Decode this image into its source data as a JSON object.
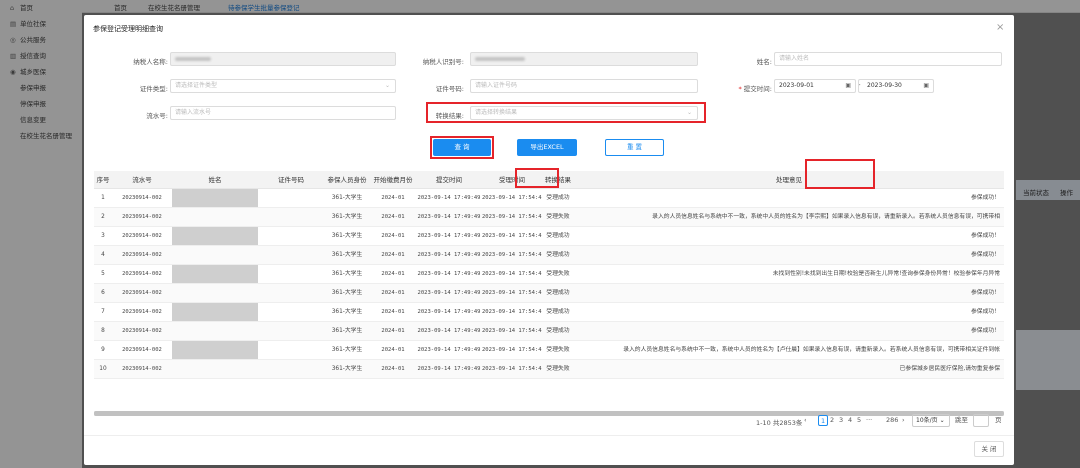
{
  "sidebar": {
    "items": [
      {
        "label": "首页",
        "icon": "home-icon",
        "glyph": "⌂"
      },
      {
        "label": "单位社保",
        "icon": "building-icon",
        "glyph": "▤"
      },
      {
        "label": "公共服务",
        "icon": "service-icon",
        "glyph": "◎"
      },
      {
        "label": "授信查询",
        "icon": "credit-icon",
        "glyph": "▥"
      },
      {
        "label": "城乡医保",
        "icon": "medical-icon",
        "glyph": "◉"
      },
      {
        "label": "参保申报",
        "sub": true
      },
      {
        "label": "停保申报",
        "sub": true
      },
      {
        "label": "信息变更",
        "sub": true
      },
      {
        "label": "在校生花名册管理",
        "sub": true
      }
    ]
  },
  "topbar": {
    "tabs": [
      "首页",
      "在校生花名册管理",
      "待参保学生批量参保登记"
    ],
    "active": 2
  },
  "background": {
    "col_status": "当前状态",
    "col_op": "操作"
  },
  "modal": {
    "title": "参保登记受理明细查询",
    "close": "×",
    "form": {
      "taxpayer_name_label": "纳税人名称:",
      "taxpayer_id_label": "纳税人识别号:",
      "name_label": "姓名:",
      "name_placeholder": "请输入姓名",
      "cert_type_label": "证件类型:",
      "cert_type_placeholder": "请选择证件类型",
      "cert_no_label": "证件号码:",
      "cert_no_placeholder": "请输入证件号码",
      "submit_time_label": "提交时间:",
      "date_from": "2023-09-01",
      "date_to": "2023-09-30",
      "date_sep": "-",
      "serial_label": "流水号:",
      "serial_placeholder": "请输入流水号",
      "result_label": "转换结果:",
      "result_placeholder": "请选择转换结果"
    },
    "buttons": {
      "query": "查 询",
      "export": "导出EXCEL",
      "reset": "重 置",
      "close": "关 闭"
    },
    "table": {
      "headers": [
        "序号",
        "流水号",
        "姓名",
        "证件号码",
        "参保人员身份",
        "开始缴费月份",
        "提交时间",
        "受理时间",
        "转换结果",
        "处理意见"
      ],
      "rows": [
        {
          "no": "1",
          "serial": "20230914-002",
          "identity": "361-大学生",
          "month": "2024-01",
          "submit": "2023-09-14 17:49:49",
          "accept": "2023-09-14 17:54:49",
          "result": "受理成功",
          "opinion": "参保成功！"
        },
        {
          "no": "2",
          "serial": "20230914-002",
          "identity": "361-大学生",
          "month": "2024-01",
          "submit": "2023-09-14 17:49:49",
          "accept": "2023-09-14 17:54:48",
          "result": "受理失败",
          "opinion": "录入的人员信息姓名与系统中不一致，系统中人员的姓名为【李宗熙】如果录入信息有误，请重新录入。若系统人员信息有误，可携带相"
        },
        {
          "no": "3",
          "serial": "20230914-002",
          "identity": "361-大学生",
          "month": "2024-01",
          "submit": "2023-09-14 17:49:49",
          "accept": "2023-09-14 17:54:48",
          "result": "受理成功",
          "opinion": "参保成功！"
        },
        {
          "no": "4",
          "serial": "20230914-002",
          "identity": "361-大学生",
          "month": "2024-01",
          "submit": "2023-09-14 17:49:49",
          "accept": "2023-09-14 17:54:47",
          "result": "受理成功",
          "opinion": "参保成功！"
        },
        {
          "no": "5",
          "serial": "20230914-002",
          "identity": "361-大学生",
          "month": "2024-01",
          "submit": "2023-09-14 17:49:49",
          "accept": "2023-09-14 17:54:46",
          "result": "受理失败",
          "opinion": "未找到性别!未找到出生日期!校验是否新生儿异常!查询参保身份异常！校验参保年月异常"
        },
        {
          "no": "6",
          "serial": "20230914-002",
          "identity": "361-大学生",
          "month": "2024-01",
          "submit": "2023-09-14 17:49:49",
          "accept": "2023-09-14 17:54:46",
          "result": "受理成功",
          "opinion": "参保成功！"
        },
        {
          "no": "7",
          "serial": "20230914-002",
          "identity": "361-大学生",
          "month": "2024-01",
          "submit": "2023-09-14 17:49:49",
          "accept": "2023-09-14 17:54:45",
          "result": "受理成功",
          "opinion": "参保成功！"
        },
        {
          "no": "8",
          "serial": "20230914-002",
          "identity": "361-大学生",
          "month": "2024-01",
          "submit": "2023-09-14 17:49:49",
          "accept": "2023-09-14 17:54:44",
          "result": "受理成功",
          "opinion": "参保成功！"
        },
        {
          "no": "9",
          "serial": "20230914-002",
          "identity": "361-大学生",
          "month": "2024-01",
          "submit": "2023-09-14 17:49:49",
          "accept": "2023-09-14 17:54:43",
          "result": "受理失败",
          "opinion": "录入的人员信息姓名与系统中不一致，系统中人员的姓名为【卢仕晨】如果录入信息有误，请重新录入。若系统人员信息有误，可携带相关证件到帐"
        },
        {
          "no": "10",
          "serial": "20230914-002",
          "identity": "361-大学生",
          "month": "2024-01",
          "submit": "2023-09-14 17:49:49",
          "accept": "2023-09-14 17:54:42",
          "result": "受理失败",
          "opinion": "已参保城乡居民医疗保险,请勿重复参保"
        }
      ]
    },
    "pagination": {
      "total": "1-10 共2853条",
      "pages": [
        "1",
        "2",
        "3",
        "4",
        "5",
        "···",
        "286"
      ],
      "current": "1",
      "prev": "‹",
      "next": "›",
      "page_size": "10条/页",
      "goto": "跳至",
      "page_unit": "页"
    }
  },
  "accent": "#1a8cf0",
  "highlight": "#e5242a"
}
